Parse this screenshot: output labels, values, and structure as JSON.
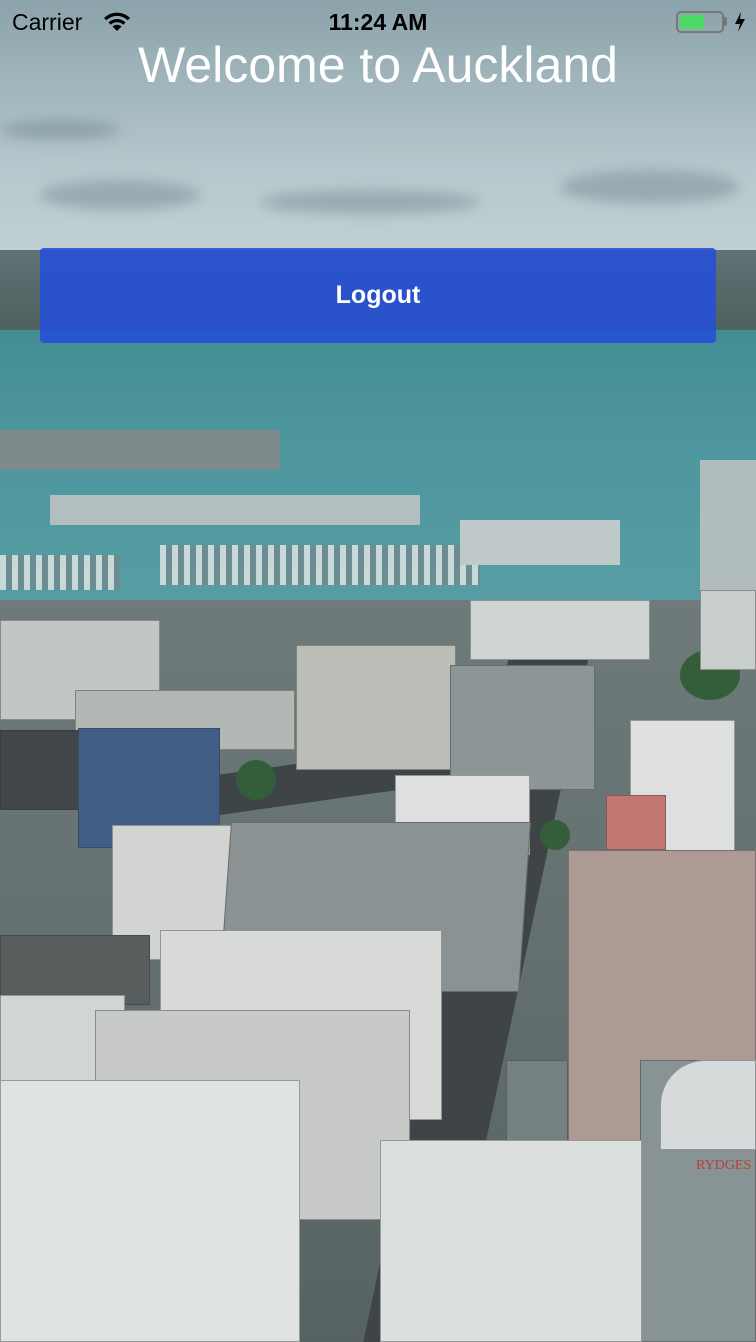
{
  "status_bar": {
    "carrier": "Carrier",
    "time": "11:24 AM",
    "wifi_icon": "wifi-icon",
    "battery_icon": "battery-icon",
    "charging_icon": "charging-bolt-icon",
    "battery_color": "#4cd964"
  },
  "main": {
    "title": "Welcome to Auckland",
    "logout_label": "Logout",
    "button_color": "#2650d6"
  },
  "background": {
    "signage_text": "RYDGES"
  }
}
